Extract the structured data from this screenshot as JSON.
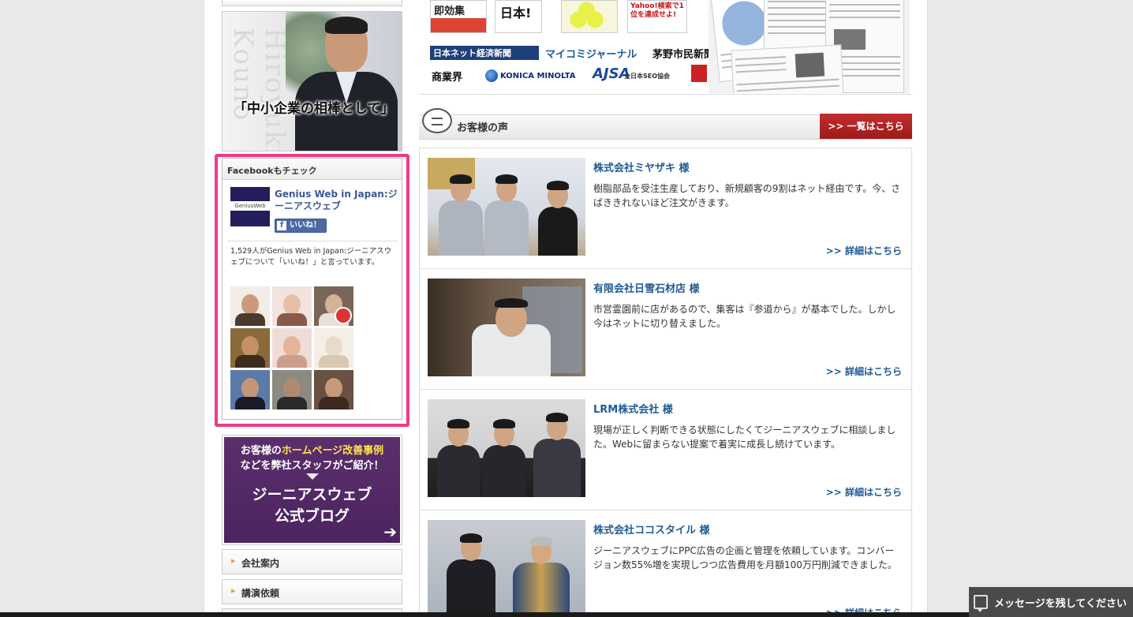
{
  "portrait": {
    "vertical_name": "Hiroyuki Kouno",
    "caption": "「中小企業の相棒として」"
  },
  "facebook": {
    "header": "Facebookもチェック",
    "page_logo_text": "GeniusWeb",
    "page_name": "Genius Web in Japan:ジーニアスウェブ",
    "like_label": "いいね！",
    "like_count_text": "1,529人がGenius Web in Japan:ジーニアスウェブについて「いいね！」と言っています。"
  },
  "promo": {
    "line1_a": "お客様の",
    "line1_hl": "ホームページ改善事例",
    "line1_b": "などを弊社スタッフがご紹介！",
    "line2_a": "ジーニアスウェブ",
    "line2_b": "公式ブログ",
    "arrow": "➔"
  },
  "sidebar_links": [
    {
      "label": "会社案内"
    },
    {
      "label": "講演依頼"
    }
  ],
  "press": {
    "logos": [
      "日本ネット経済新聞",
      "マイコミジャーナル",
      "茅野市民新聞",
      "商業界",
      "KONICA MINOLTA",
      "AJSA",
      "全日本SEO協会"
    ],
    "book_titles": [
      "即効集",
      "日本!",
      "Yahoo!検索で1位を達成せよ!"
    ]
  },
  "voice": {
    "title": "お客様の声",
    "more_label": ">> 一覧はこちら"
  },
  "cases": [
    {
      "name": "株式会社ミヤザキ 様",
      "desc": "樹脂部品を受注生産しており、新規顧客の9割はネット経由です。今、さばききれないほど注文がきます。",
      "detail": ">>  詳細はこちら"
    },
    {
      "name": "有限会社日雪石材店 様",
      "desc": "市営霊園前に店があるので、集客は『参道から』が基本でした。しかし今はネットに切り替えました。",
      "detail": ">>  詳細はこちら"
    },
    {
      "name": "LRM株式会社 様",
      "desc": "現場が正しく判断できる状態にしたくてジーニアスウェブに相談しました。Webに留まらない提案で着実に成長し続けています。",
      "detail": ">>  詳細はこちら"
    },
    {
      "name": "株式会社ココスタイル 様",
      "desc": "ジーニアスウェブにPPC広告の企画と管理を依頼しています。コンバージョン数55%増を実現しつつ広告費用を月額100万円削減できました。",
      "detail": ">>  詳細はこちら"
    }
  ],
  "message_tab": {
    "label": "メッセージを残してください"
  },
  "colors": {
    "accent_red": "#b22424",
    "link_blue": "#1f5a96",
    "highlight_pink": "#ee3b86",
    "promo_purple": "#4b2460",
    "facebook_blue": "#3b5998"
  }
}
